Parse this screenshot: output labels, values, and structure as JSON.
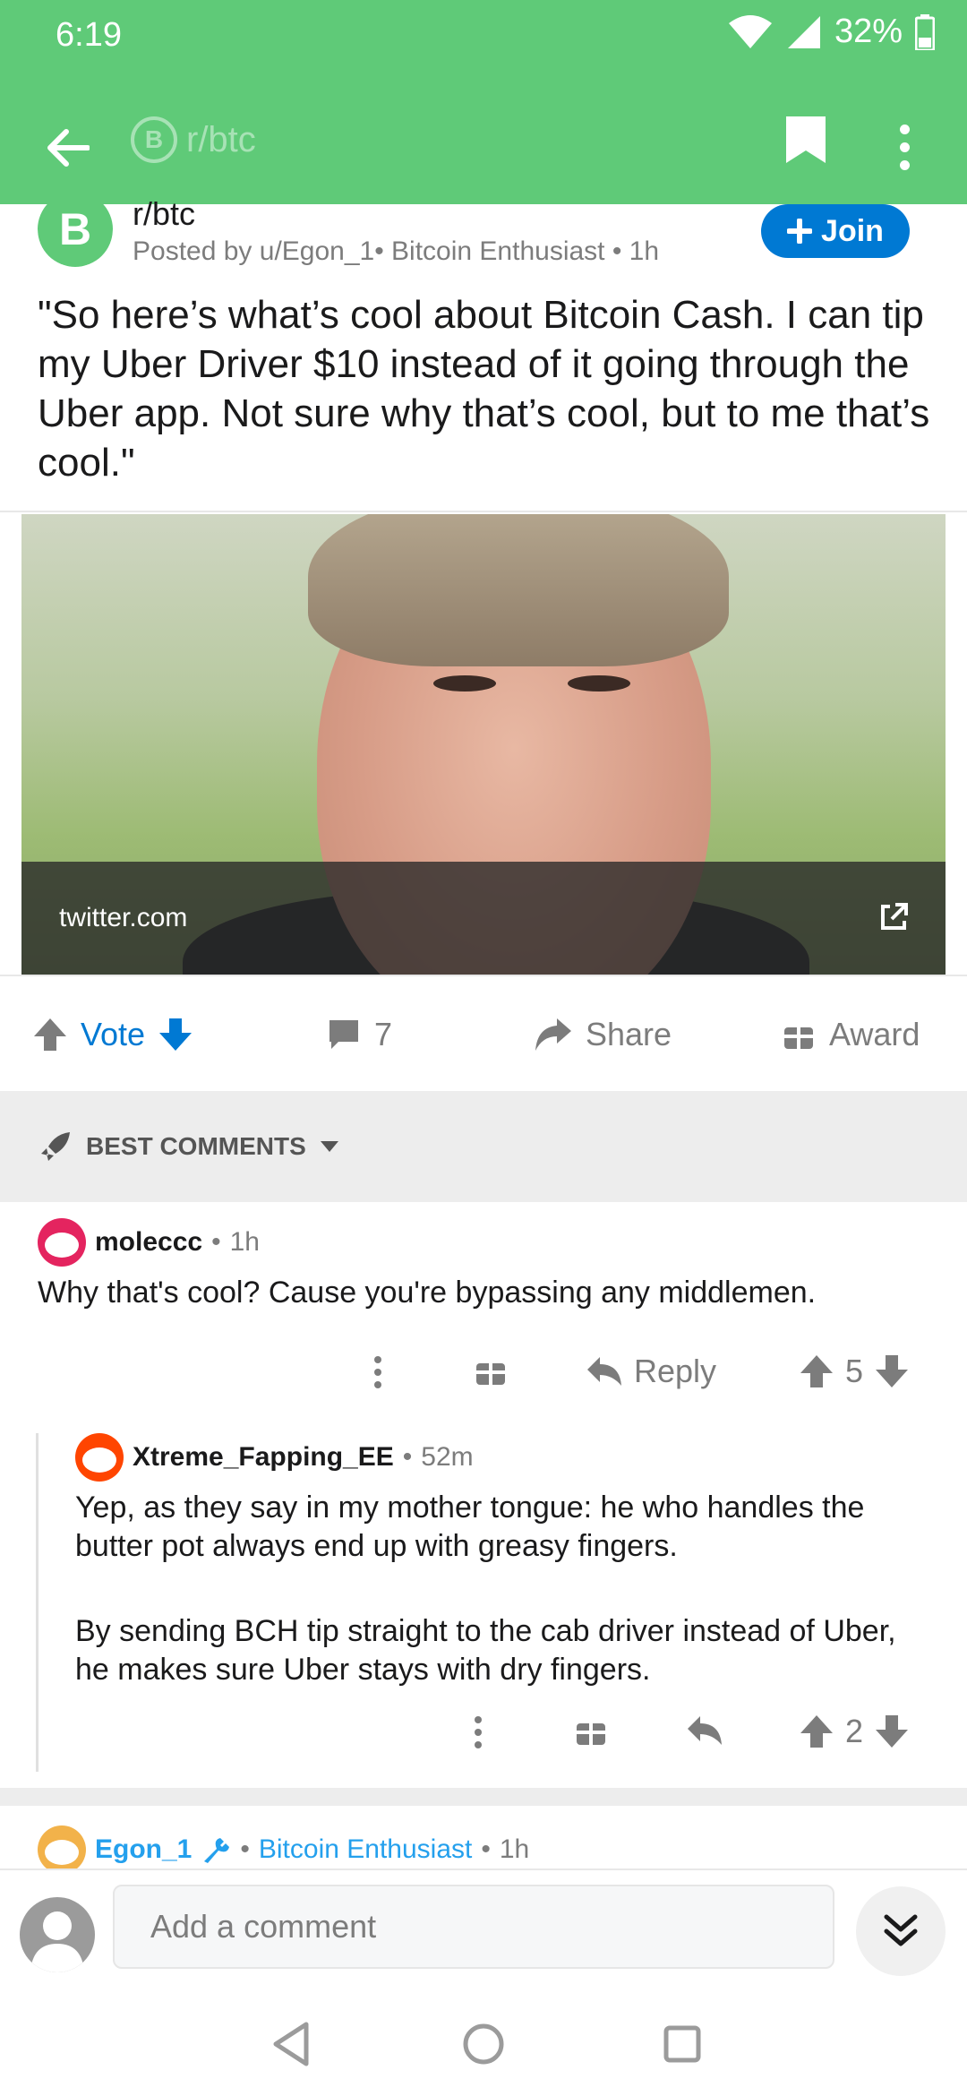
{
  "status_bar": {
    "time": "6:19",
    "battery": "32%"
  },
  "app_bar": {
    "subreddit": "r/btc",
    "coin_symbol": "B"
  },
  "post": {
    "subreddit": "r/btc",
    "posted_by": "Posted by u/Egon_1• Bitcoin Enthusiast • 1h",
    "join_label": "Join",
    "title": "\"So here’s what’s cool about Bitcoin Cash. I can tip my Uber Driver $10 instead of it going through the Uber app. Not sure why that’s cool, but to me that’s cool.\"",
    "link_domain": "twitter.com"
  },
  "actions": {
    "vote_label": "Vote",
    "comment_count": "7",
    "share_label": "Share",
    "award_label": "Award"
  },
  "sort": {
    "label": "BEST COMMENTS"
  },
  "comments": [
    {
      "user": "moleccc",
      "time": "1h",
      "body": "Why that's cool? Cause you're bypassing any middlemen.",
      "reply_label": "Reply",
      "score": "5"
    },
    {
      "user": "Xtreme_Fapping_EE",
      "time": "52m",
      "body_1": "Yep, as they say in my mother tongue: he who handles the butter pot always end up with greasy fingers.",
      "body_2": "By sending BCH tip straight to the cab driver instead of Uber, he makes sure Uber stays with dry fingers.",
      "score": "2"
    },
    {
      "user": "Egon_1",
      "flair": "Bitcoin Enthusiast",
      "time": "1h"
    }
  ],
  "comment_bar": {
    "placeholder": "Add a comment"
  },
  "colors": {
    "brand_green": "#5fca78",
    "link_blue": "#0079d3",
    "flair_blue": "#24a0ed"
  }
}
